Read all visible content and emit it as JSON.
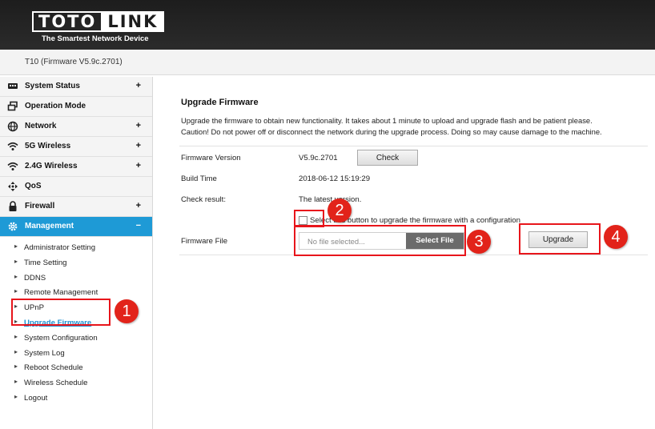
{
  "brand": {
    "logo_left": "TOTO",
    "logo_right": "LINK",
    "tagline": "The Smartest Network Device"
  },
  "model": "T10 (Firmware V5.9c.2701)",
  "sidebar": {
    "items": [
      {
        "label": "System Status",
        "toggle": "+"
      },
      {
        "label": "Operation Mode",
        "toggle": ""
      },
      {
        "label": "Network",
        "toggle": "+"
      },
      {
        "label": "5G Wireless",
        "toggle": "+"
      },
      {
        "label": "2.4G Wireless",
        "toggle": "+"
      },
      {
        "label": "QoS",
        "toggle": ""
      },
      {
        "label": "Firewall",
        "toggle": "+"
      },
      {
        "label": "Management",
        "toggle": "−"
      }
    ],
    "sub_items": [
      "Administrator Setting",
      "Time Setting",
      "DDNS",
      "Remote Management",
      "UPnP",
      "Upgrade Firmware",
      "System Configuration",
      "System Log",
      "Reboot Schedule",
      "Wireless Schedule",
      "Logout"
    ]
  },
  "main": {
    "title": "Upgrade Firmware",
    "desc1": "Upgrade the firmware to obtain new functionality. It takes about 1 minute to upload and upgrade flash and be patient please.",
    "desc2": "Caution! Do not power off or disconnect the network during the upgrade process. Doing so may cause damage to the machine.",
    "firmware_version_label": "Firmware Version",
    "firmware_version": "V5.9c.2701",
    "check_label": "Check",
    "build_time_label": "Build Time",
    "build_time": "2018-06-12 15:19:29",
    "check_result_label": "Check result:",
    "check_result": "The latest version.",
    "config_checkbox_label": "Select this button to upgrade the firmware with a configuration",
    "firmware_file_label": "Firmware File",
    "file_placeholder": "No file selected...",
    "select_file_label": "Select File",
    "upgrade_label": "Upgrade"
  },
  "annotations": [
    "1",
    "2",
    "3",
    "4"
  ],
  "colors": {
    "accent": "#1e9ad6",
    "annotation": "#e2231a",
    "header": "#1d1d1d"
  }
}
